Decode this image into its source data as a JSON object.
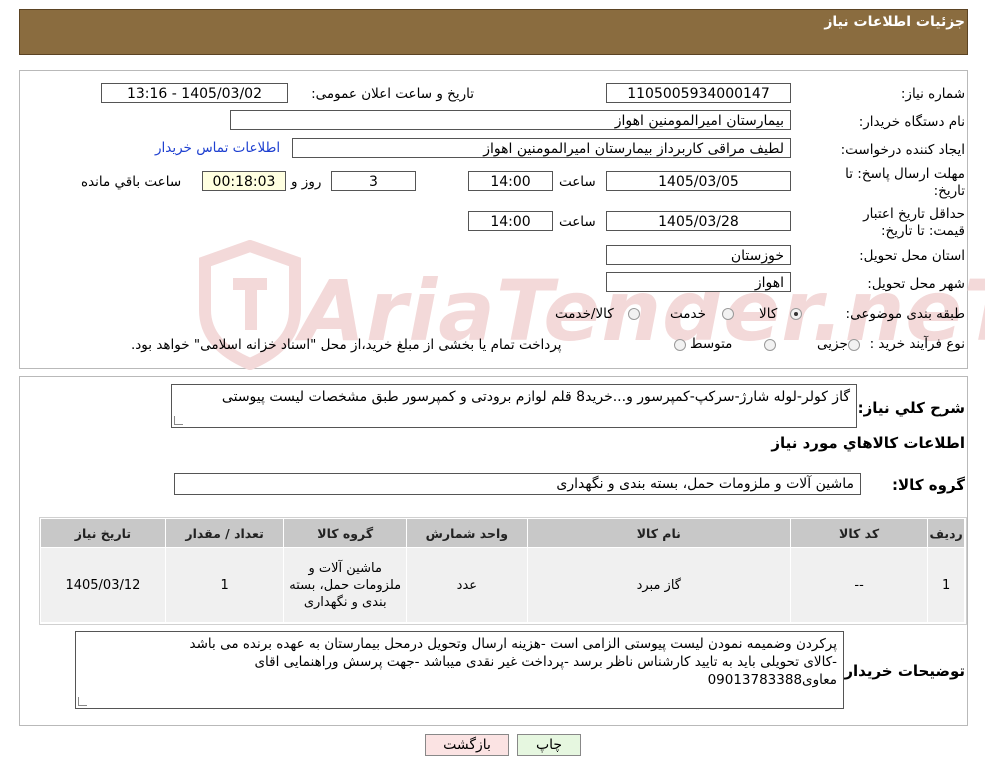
{
  "header": {
    "title": "جزئیات اطلاعات نیاز"
  },
  "details": {
    "need_number_label": "شماره نیاز:",
    "need_number": "1105005934000147",
    "announce_label": "تاریخ و ساعت اعلان عمومی:",
    "announce_value": "1405/03/02 - 13:16",
    "buyer_org_label": "نام دستگاه خریدار:",
    "buyer_org": "بیمارستان امیرالمومنین اهواز",
    "creator_label": "ایجاد کننده درخواست:",
    "creator": "لطیف مراقی کاربرداز بیمارستان امیرالمومنین اهواز",
    "contact_link": "اطلاعات تماس خریدار",
    "reply_deadline_label": "مهلت ارسال پاسخ: تا تاریخ:",
    "reply_date": "1405/03/05",
    "time_label": "ساعت",
    "reply_time": "14:00",
    "days_value": "3",
    "days_label": "روز و",
    "remaining_time": "00:18:03",
    "remaining_label": "ساعت باقي مانده",
    "validity_label": "حداقل تاریخ اعتبار قیمت: تا تاریخ:",
    "validity_date": "1405/03/28",
    "validity_time": "14:00",
    "province_label": "استان محل تحویل:",
    "province": "خوزستان",
    "city_label": "شهر محل تحویل:",
    "city": "اهواز",
    "category_label": "طبقه بندی موضوعی:",
    "category_options": [
      "کالا",
      "خدمت",
      "کالا/خدمت"
    ],
    "process_label": "نوع فرآیند خرید :",
    "process_options": [
      "جزیی",
      "متوسط"
    ],
    "process_note": "پرداخت تمام یا بخشی از مبلغ خرید،از محل \"اسناد خزانه اسلامی\" خواهد بود."
  },
  "summary": {
    "desc_label": "شرح کلي نیاز:",
    "desc_value": "گاز کولر-لوله شارژ-سرکپ-کمپرسور و...خرید8 قلم لوازم برودتی و کمپرسور طبق مشخصات لیست پیوستی",
    "items_heading": "اطلاعات کالاهاي مورد نیاز",
    "group_label": "گروه کالا:",
    "group_value": "ماشین آلات و ملزومات حمل، بسته بندی و نگهداری"
  },
  "table": {
    "headers": [
      "ردیف",
      "کد کالا",
      "نام کالا",
      "واحد شمارش",
      "گروه کالا",
      "تعداد / مقدار",
      "تاریخ نیاز"
    ],
    "rows": [
      [
        "1",
        "--",
        "گاز مبرد",
        "عدد",
        "ماشین آلات و ملزومات حمل، بسته بندی و نگهداری",
        "1",
        "1405/03/12"
      ]
    ]
  },
  "buyer_notes": {
    "label": "توضیحات خریدار:",
    "lines": [
      "پرکردن وضمیمه نمودن لیست پیوستی الزامی است -هزینه ارسال وتحویل درمحل بیمارستان به عهده برنده  می باشد",
      "-کالای تحویلی باید به تایید کارشناس ناظر  برسد -پرداخت غیر  نقدی میباشد -جهت پرسش وراهنمایی اقای",
      "معاوی09013783388"
    ]
  },
  "buttons": {
    "print": "چاپ",
    "back": "بازگشت"
  },
  "watermark": {
    "text": "AriaTender.neT"
  }
}
